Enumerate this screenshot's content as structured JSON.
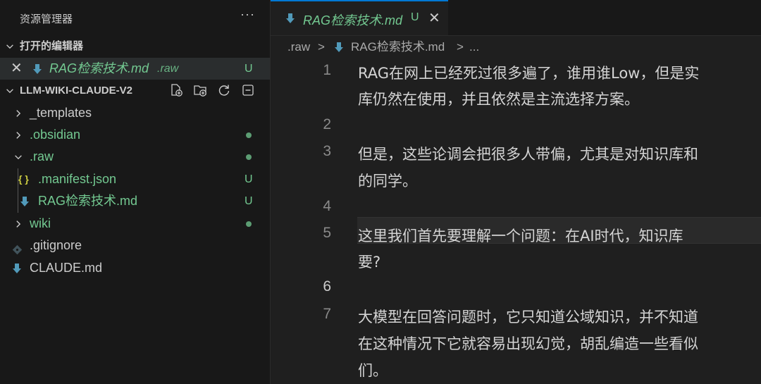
{
  "explorer": {
    "title": "资源管理器",
    "more": "···",
    "open_editors": {
      "label": "打开的编辑器",
      "items": [
        {
          "name": "RAG检索技术.md",
          "description": ".raw",
          "badge": "U",
          "close": "✕"
        }
      ]
    },
    "project": {
      "label": "LLM-WIKI-CLAUDE-V2",
      "actions": [
        "new-file-icon",
        "new-folder-icon",
        "refresh-icon",
        "collapse-all-icon"
      ],
      "items": [
        {
          "name": "_templates",
          "type": "folder",
          "state": "collapsed"
        },
        {
          "name": ".obsidian",
          "type": "folder",
          "state": "collapsed",
          "status": "dot"
        },
        {
          "name": ".raw",
          "type": "folder",
          "state": "expanded",
          "status": "dot"
        },
        {
          "name": ".manifest.json",
          "type": "file",
          "icon": "{ }",
          "badge": "U"
        },
        {
          "name": "RAG检索技术.md",
          "type": "file",
          "badge": "U"
        },
        {
          "name": "wiki",
          "type": "folder",
          "state": "collapsed",
          "status": "dot"
        },
        {
          "name": ".gitignore",
          "type": "file"
        },
        {
          "name": "CLAUDE.md",
          "type": "file"
        }
      ]
    }
  },
  "editor": {
    "tab": {
      "name": "RAG检索技术.md",
      "badge": "U",
      "close": "✕"
    },
    "breadcrumb": [
      ".raw",
      ">",
      "RAG检索技术.md",
      ">",
      "..."
    ],
    "lines": [
      {
        "n": "1",
        "text": "RAG在网上已经死过很多遍了，谁用谁Low，但是实"
      },
      {
        "n": "",
        "text": "库仍然在使用，并且依然是主流选择方案。"
      },
      {
        "n": "2",
        "text": ""
      },
      {
        "n": "3",
        "text": "但是，这些论调会把很多人带偏，尤其是对知识库和"
      },
      {
        "n": "",
        "text": "的同学。"
      },
      {
        "n": "4",
        "text": ""
      },
      {
        "n": "5",
        "text": "这里我们首先要理解一个问题：在AI时代，知识库"
      },
      {
        "n": "",
        "text": "要?"
      },
      {
        "n": "6",
        "text": ""
      },
      {
        "n": "7",
        "text": "大模型在回答问题时，它只知道公域知识，并不知道"
      },
      {
        "n": "",
        "text": "在这种情况下它就容易出现幻觉，胡乱编造一些看似"
      },
      {
        "n": "",
        "text": "们。"
      }
    ]
  },
  "colors": {
    "accent": "#0078d4",
    "git_untracked": "#73c991",
    "sidebar_bg": "#181818",
    "editor_bg": "#1f1f1f"
  }
}
